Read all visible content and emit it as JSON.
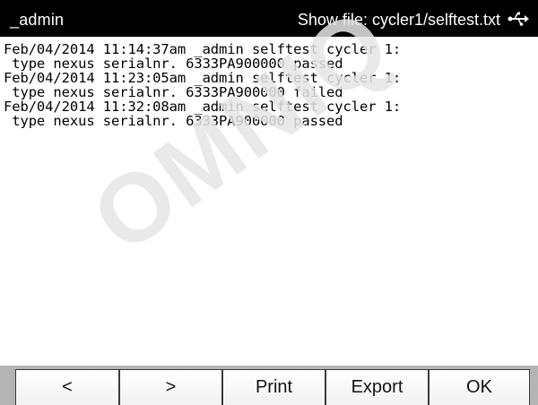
{
  "titlebar": {
    "user": "_admin",
    "title": "Show file: cycler1/selftest.txt",
    "icon": "usb-icon"
  },
  "log": {
    "lines": [
      "Feb/04/2014 11:14:37am _admin selftest cycler 1:",
      " type nexus serialnr. 6333PA900000 passed",
      "Feb/04/2014 11:23:05am _admin selftest cycler 1:",
      " type nexus serialnr. 6333PA900000 failed",
      "Feb/04/2014 11:32:08am _admin selftest cycler 1:",
      " type nexus serialnr. 6333PA900000 passed"
    ]
  },
  "buttons": {
    "prev": "<",
    "next": ">",
    "print": "Print",
    "export": "Export",
    "ok": "OK"
  },
  "watermark": "OMNIQ"
}
